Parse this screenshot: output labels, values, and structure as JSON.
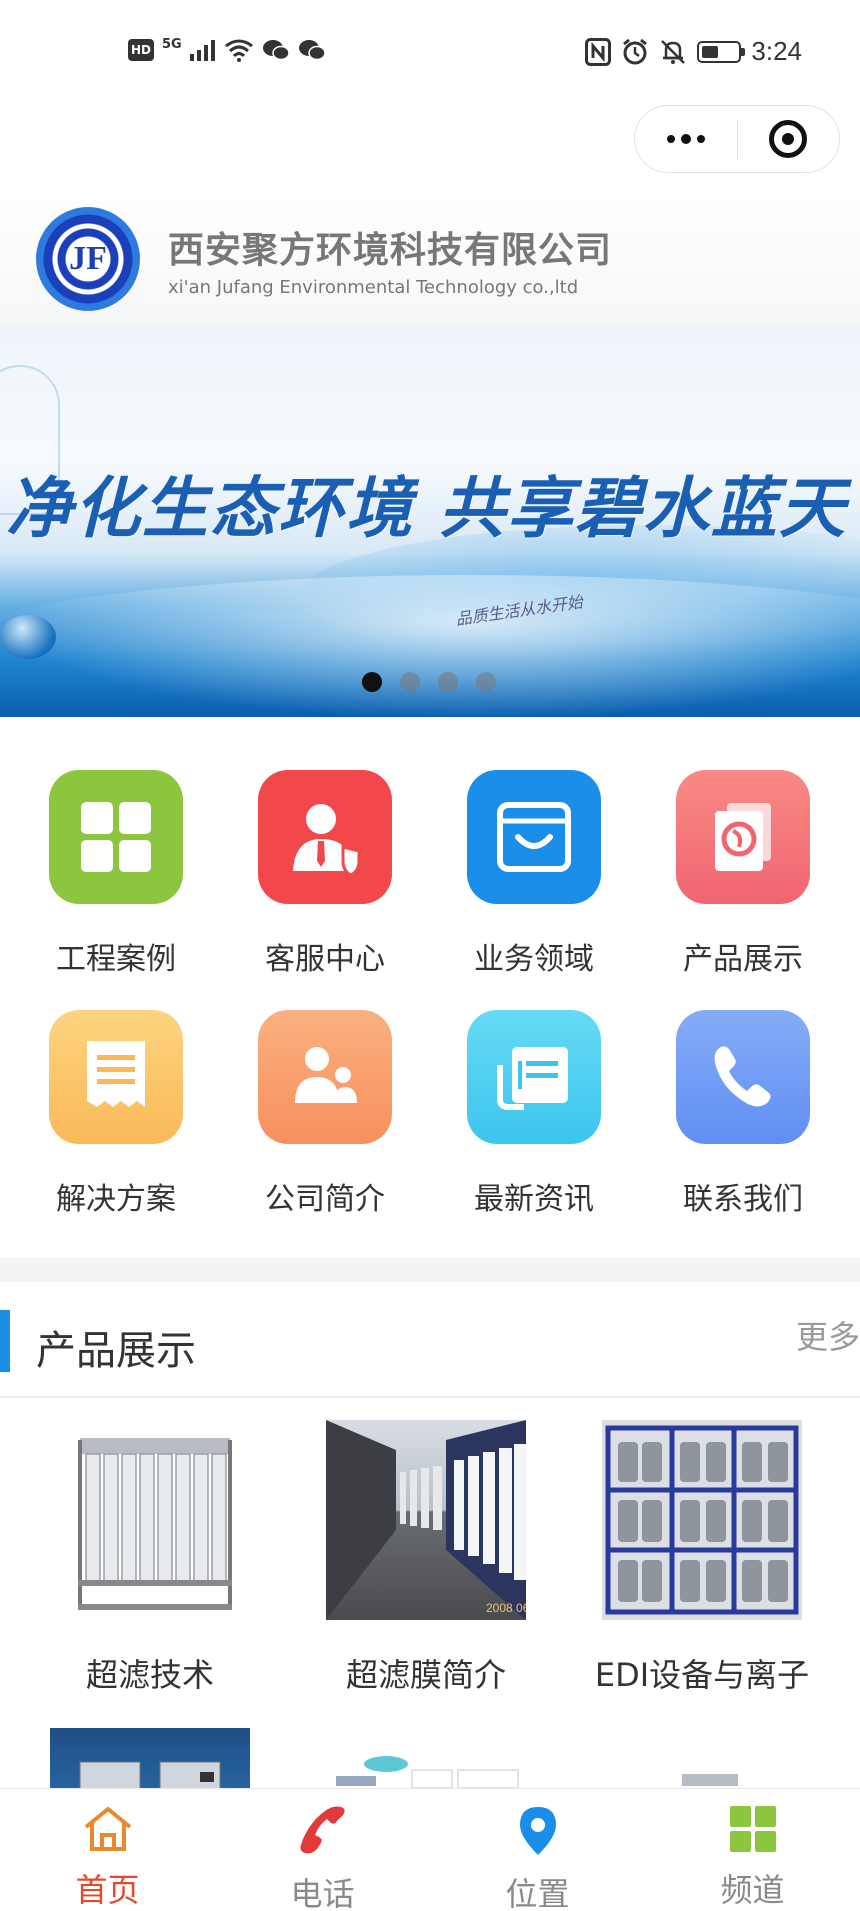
{
  "status_bar": {
    "hd": "HD",
    "network": "5G",
    "time": "3:24",
    "battery_level": 0.45,
    "icons": [
      "hd-icon",
      "signal-icon",
      "wifi-icon",
      "wechat-icon",
      "wechat-icon",
      "nfc-icon",
      "alarm-icon",
      "mute-icon",
      "battery-icon"
    ]
  },
  "capsule": {
    "more_icon": "more-dots-icon",
    "close_icon": "target-close-icon"
  },
  "company": {
    "logo_text": "JF",
    "name_cn": "西安聚方环境科技有限公司",
    "name_en": "xi'an Jufang Environmental Technology co.,ltd"
  },
  "banner": {
    "slogan": "净化生态环境 共享碧水蓝天",
    "subslogan": "品质生活从水开始",
    "slide_count": 4,
    "active_slide": 1
  },
  "grid": [
    {
      "label": "工程案例",
      "icon": "grid-four-icon",
      "color": "#8cc63f"
    },
    {
      "label": "客服中心",
      "icon": "customer-service-icon",
      "color": "#f2474b"
    },
    {
      "label": "业务领域",
      "icon": "shopping-bag-icon",
      "color": "#1a8ee8"
    },
    {
      "label": "产品展示",
      "icon": "product-book-icon",
      "color": "#f4767a"
    },
    {
      "label": "解决方案",
      "icon": "receipt-icon",
      "color": "#fdc66c"
    },
    {
      "label": "公司简介",
      "icon": "people-icon",
      "color": "#f9a16e"
    },
    {
      "label": "最新资讯",
      "icon": "news-icon",
      "color": "#4fd0f2"
    },
    {
      "label": "联系我们",
      "icon": "phone-icon",
      "color": "#6e9cf5"
    }
  ],
  "section": {
    "title": "产品展示",
    "more": "更多"
  },
  "products": [
    {
      "label": "超滤技术"
    },
    {
      "label": "超滤膜简介"
    },
    {
      "label": "EDI设备与离子"
    }
  ],
  "tabbar": [
    {
      "label": "首页",
      "icon": "home-icon",
      "active": true
    },
    {
      "label": "电话",
      "icon": "phone-icon",
      "active": false
    },
    {
      "label": "位置",
      "icon": "location-pin-icon",
      "active": false
    },
    {
      "label": "频道",
      "icon": "channel-grid-icon",
      "active": false
    }
  ],
  "colors": {
    "accent_blue": "#1a8ee0",
    "active_tab": "#e04b2b",
    "inactive_tab": "#8a8a8a"
  }
}
